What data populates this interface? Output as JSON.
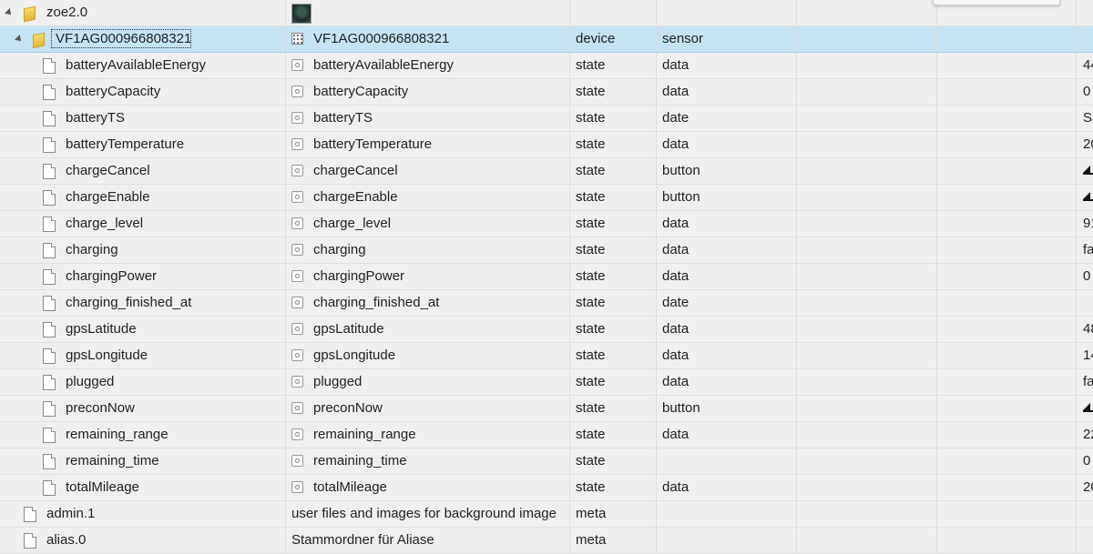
{
  "tree": {
    "root": {
      "id": "zoe2.0"
    },
    "device": {
      "id": "VF1AG000966808321",
      "name": "VF1AG000966808321",
      "type": "device",
      "role": "sensor"
    },
    "states": [
      {
        "id": "batteryAvailableEnergy",
        "name": "batteryAvailableEnergy",
        "type": "state",
        "role": "data",
        "value": "44"
      },
      {
        "id": "batteryCapacity",
        "name": "batteryCapacity",
        "type": "state",
        "role": "data",
        "value": "0"
      },
      {
        "id": "batteryTS",
        "name": "batteryTS",
        "type": "state",
        "role": "date",
        "value": "Sa"
      },
      {
        "id": "batteryTemperature",
        "name": "batteryTemperature",
        "type": "state",
        "role": "data",
        "value": "20"
      },
      {
        "id": "chargeCancel",
        "name": "chargeCancel",
        "type": "state",
        "role": "button",
        "value": ""
      },
      {
        "id": "chargeEnable",
        "name": "chargeEnable",
        "type": "state",
        "role": "button",
        "value": ""
      },
      {
        "id": "charge_level",
        "name": "charge_level",
        "type": "state",
        "role": "data",
        "value": "91"
      },
      {
        "id": "charging",
        "name": "charging",
        "type": "state",
        "role": "data",
        "value": "fa"
      },
      {
        "id": "chargingPower",
        "name": "chargingPower",
        "type": "state",
        "role": "data",
        "value": "0"
      },
      {
        "id": "charging_finished_at",
        "name": "charging_finished_at",
        "type": "state",
        "role": "date",
        "value": ""
      },
      {
        "id": "gpsLatitude",
        "name": "gpsLatitude",
        "type": "state",
        "role": "data",
        "value": "48"
      },
      {
        "id": "gpsLongitude",
        "name": "gpsLongitude",
        "type": "state",
        "role": "data",
        "value": "14"
      },
      {
        "id": "plugged",
        "name": "plugged",
        "type": "state",
        "role": "data",
        "value": "fa"
      },
      {
        "id": "preconNow",
        "name": "preconNow",
        "type": "state",
        "role": "button",
        "value": ""
      },
      {
        "id": "remaining_range",
        "name": "remaining_range",
        "type": "state",
        "role": "data",
        "value": "22"
      },
      {
        "id": "remaining_time",
        "name": "remaining_time",
        "type": "state",
        "role": "",
        "value": "0"
      },
      {
        "id": "totalMileage",
        "name": "totalMileage",
        "type": "state",
        "role": "data",
        "value": "20"
      }
    ],
    "adapters": [
      {
        "id": "admin.1",
        "name": "user files and images for background image",
        "type": "meta"
      },
      {
        "id": "alias.0",
        "name": "Stammordner für Aliase",
        "type": "meta"
      }
    ]
  },
  "icons": {
    "expander": "triangle-expand-icon",
    "folder": "folder-icon",
    "file": "file-icon",
    "state": "state-icon",
    "device": "device-icon",
    "button": "button-press-icon"
  }
}
